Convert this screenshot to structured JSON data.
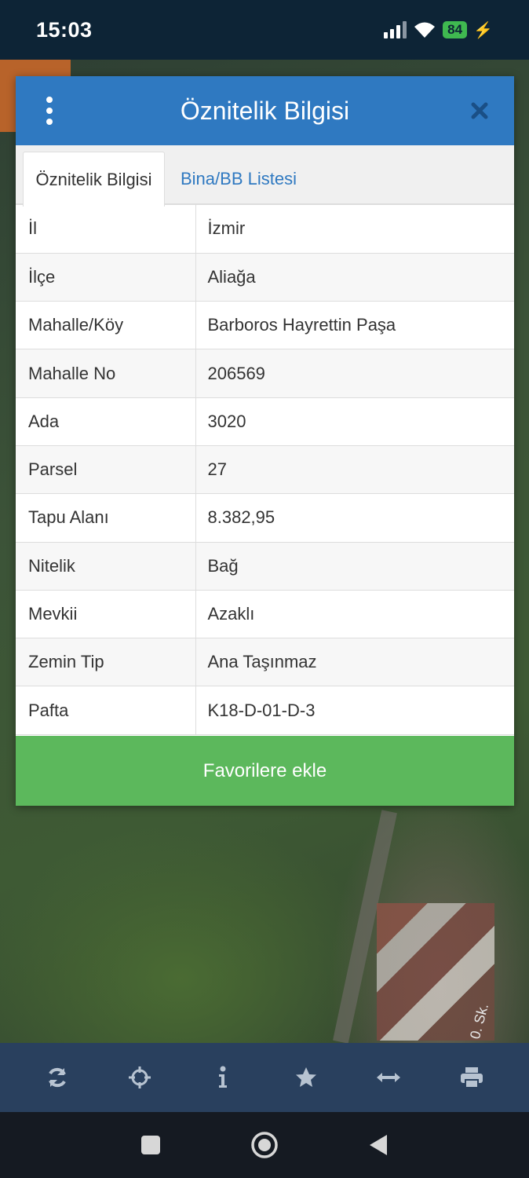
{
  "status_bar": {
    "time": "15:03",
    "battery": "84",
    "icons": [
      "signal-icon",
      "wifi-icon",
      "battery-icon",
      "charging-bolt-icon"
    ]
  },
  "map": {
    "street_label": "0. Sk."
  },
  "dialog": {
    "title": "Öznitelik Bilgisi",
    "tabs": [
      {
        "label": "Öznitelik Bilgisi",
        "active": true
      },
      {
        "label": "Bina/BB Listesi",
        "active": false
      }
    ],
    "rows": [
      {
        "key": "İl",
        "value": "İzmir"
      },
      {
        "key": "İlçe",
        "value": "Aliağa"
      },
      {
        "key": "Mahalle/Köy",
        "value": "Barboros Hayrettin Paşa"
      },
      {
        "key": "Mahalle No",
        "value": "206569"
      },
      {
        "key": "Ada",
        "value": "3020"
      },
      {
        "key": "Parsel",
        "value": "27"
      },
      {
        "key": "Tapu Alanı",
        "value": "8.382,95"
      },
      {
        "key": "Nitelik",
        "value": "Bağ"
      },
      {
        "key": "Mevkii",
        "value": "Azaklı"
      },
      {
        "key": "Zemin Tip",
        "value": "Ana Taşınmaz"
      },
      {
        "key": "Pafta",
        "value": "K18-D-01-D-3"
      }
    ],
    "favorite_button": "Favorilere ekle"
  },
  "toolbar": {
    "icons": [
      "refresh-icon",
      "crosshair-icon",
      "info-icon",
      "star-icon",
      "measure-icon",
      "print-icon"
    ]
  },
  "navbar": {
    "icons": [
      "recent-apps-icon",
      "home-icon",
      "back-icon"
    ]
  },
  "colors": {
    "header_blue": "#2f79c1",
    "button_green": "#5cb85c",
    "toolbar": "#29405e"
  }
}
